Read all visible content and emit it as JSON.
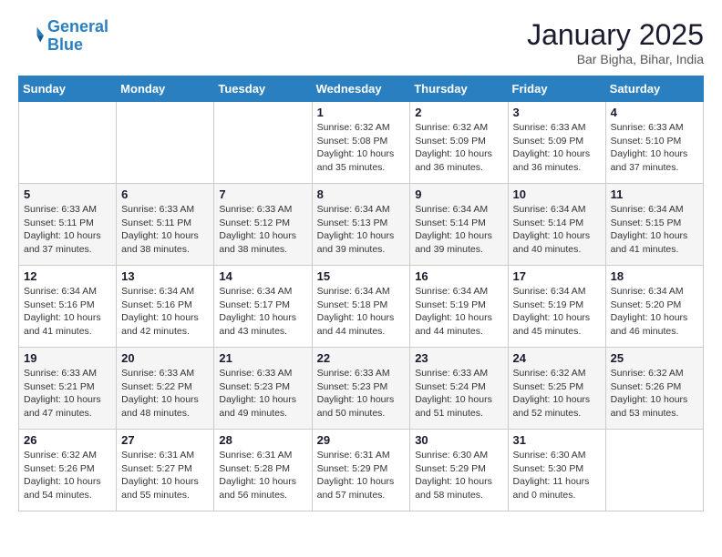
{
  "header": {
    "logo_line1": "General",
    "logo_line2": "Blue",
    "month_year": "January 2025",
    "location": "Bar Bigha, Bihar, India"
  },
  "weekdays": [
    "Sunday",
    "Monday",
    "Tuesday",
    "Wednesday",
    "Thursday",
    "Friday",
    "Saturday"
  ],
  "weeks": [
    [
      {
        "day": "",
        "info": ""
      },
      {
        "day": "",
        "info": ""
      },
      {
        "day": "",
        "info": ""
      },
      {
        "day": "1",
        "info": "Sunrise: 6:32 AM\nSunset: 5:08 PM\nDaylight: 10 hours\nand 35 minutes."
      },
      {
        "day": "2",
        "info": "Sunrise: 6:32 AM\nSunset: 5:09 PM\nDaylight: 10 hours\nand 36 minutes."
      },
      {
        "day": "3",
        "info": "Sunrise: 6:33 AM\nSunset: 5:09 PM\nDaylight: 10 hours\nand 36 minutes."
      },
      {
        "day": "4",
        "info": "Sunrise: 6:33 AM\nSunset: 5:10 PM\nDaylight: 10 hours\nand 37 minutes."
      }
    ],
    [
      {
        "day": "5",
        "info": "Sunrise: 6:33 AM\nSunset: 5:11 PM\nDaylight: 10 hours\nand 37 minutes."
      },
      {
        "day": "6",
        "info": "Sunrise: 6:33 AM\nSunset: 5:11 PM\nDaylight: 10 hours\nand 38 minutes."
      },
      {
        "day": "7",
        "info": "Sunrise: 6:33 AM\nSunset: 5:12 PM\nDaylight: 10 hours\nand 38 minutes."
      },
      {
        "day": "8",
        "info": "Sunrise: 6:34 AM\nSunset: 5:13 PM\nDaylight: 10 hours\nand 39 minutes."
      },
      {
        "day": "9",
        "info": "Sunrise: 6:34 AM\nSunset: 5:14 PM\nDaylight: 10 hours\nand 39 minutes."
      },
      {
        "day": "10",
        "info": "Sunrise: 6:34 AM\nSunset: 5:14 PM\nDaylight: 10 hours\nand 40 minutes."
      },
      {
        "day": "11",
        "info": "Sunrise: 6:34 AM\nSunset: 5:15 PM\nDaylight: 10 hours\nand 41 minutes."
      }
    ],
    [
      {
        "day": "12",
        "info": "Sunrise: 6:34 AM\nSunset: 5:16 PM\nDaylight: 10 hours\nand 41 minutes."
      },
      {
        "day": "13",
        "info": "Sunrise: 6:34 AM\nSunset: 5:16 PM\nDaylight: 10 hours\nand 42 minutes."
      },
      {
        "day": "14",
        "info": "Sunrise: 6:34 AM\nSunset: 5:17 PM\nDaylight: 10 hours\nand 43 minutes."
      },
      {
        "day": "15",
        "info": "Sunrise: 6:34 AM\nSunset: 5:18 PM\nDaylight: 10 hours\nand 44 minutes."
      },
      {
        "day": "16",
        "info": "Sunrise: 6:34 AM\nSunset: 5:19 PM\nDaylight: 10 hours\nand 44 minutes."
      },
      {
        "day": "17",
        "info": "Sunrise: 6:34 AM\nSunset: 5:19 PM\nDaylight: 10 hours\nand 45 minutes."
      },
      {
        "day": "18",
        "info": "Sunrise: 6:34 AM\nSunset: 5:20 PM\nDaylight: 10 hours\nand 46 minutes."
      }
    ],
    [
      {
        "day": "19",
        "info": "Sunrise: 6:33 AM\nSunset: 5:21 PM\nDaylight: 10 hours\nand 47 minutes."
      },
      {
        "day": "20",
        "info": "Sunrise: 6:33 AM\nSunset: 5:22 PM\nDaylight: 10 hours\nand 48 minutes."
      },
      {
        "day": "21",
        "info": "Sunrise: 6:33 AM\nSunset: 5:23 PM\nDaylight: 10 hours\nand 49 minutes."
      },
      {
        "day": "22",
        "info": "Sunrise: 6:33 AM\nSunset: 5:23 PM\nDaylight: 10 hours\nand 50 minutes."
      },
      {
        "day": "23",
        "info": "Sunrise: 6:33 AM\nSunset: 5:24 PM\nDaylight: 10 hours\nand 51 minutes."
      },
      {
        "day": "24",
        "info": "Sunrise: 6:32 AM\nSunset: 5:25 PM\nDaylight: 10 hours\nand 52 minutes."
      },
      {
        "day": "25",
        "info": "Sunrise: 6:32 AM\nSunset: 5:26 PM\nDaylight: 10 hours\nand 53 minutes."
      }
    ],
    [
      {
        "day": "26",
        "info": "Sunrise: 6:32 AM\nSunset: 5:26 PM\nDaylight: 10 hours\nand 54 minutes."
      },
      {
        "day": "27",
        "info": "Sunrise: 6:31 AM\nSunset: 5:27 PM\nDaylight: 10 hours\nand 55 minutes."
      },
      {
        "day": "28",
        "info": "Sunrise: 6:31 AM\nSunset: 5:28 PM\nDaylight: 10 hours\nand 56 minutes."
      },
      {
        "day": "29",
        "info": "Sunrise: 6:31 AM\nSunset: 5:29 PM\nDaylight: 10 hours\nand 57 minutes."
      },
      {
        "day": "30",
        "info": "Sunrise: 6:30 AM\nSunset: 5:29 PM\nDaylight: 10 hours\nand 58 minutes."
      },
      {
        "day": "31",
        "info": "Sunrise: 6:30 AM\nSunset: 5:30 PM\nDaylight: 11 hours\nand 0 minutes."
      },
      {
        "day": "",
        "info": ""
      }
    ]
  ]
}
